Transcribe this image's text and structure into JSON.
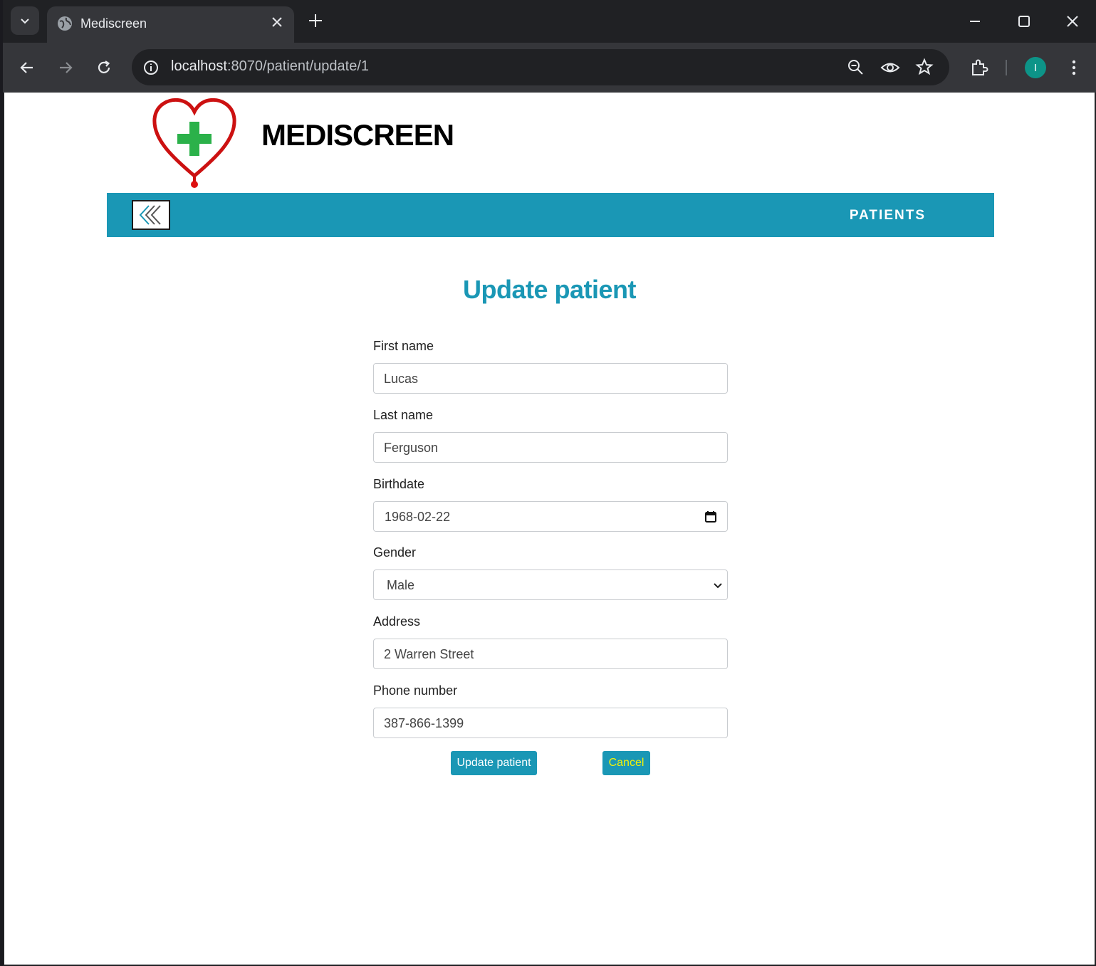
{
  "browser": {
    "tab_title": "Mediscreen",
    "url_host": "localhost",
    "url_rest": ":8070/patient/update/1",
    "profile_initial": "I"
  },
  "header": {
    "brand": "MEDISCREEN"
  },
  "navbar": {
    "patients_link": "PATIENTS"
  },
  "form": {
    "title": "Update patient",
    "first_name_label": "First name",
    "first_name_value": "Lucas",
    "last_name_label": "Last name",
    "last_name_value": "Ferguson",
    "birthdate_label": "Birthdate",
    "birthdate_value": "1968-02-22",
    "gender_label": "Gender",
    "gender_value": "Male",
    "address_label": "Address",
    "address_value": "2 Warren Street",
    "phone_label": "Phone number",
    "phone_value": "387-866-1399",
    "submit_label": "Update patient",
    "cancel_label": "Cancel"
  },
  "colors": {
    "accent": "#1a97b5",
    "cancel_text": "#f2f20a"
  }
}
